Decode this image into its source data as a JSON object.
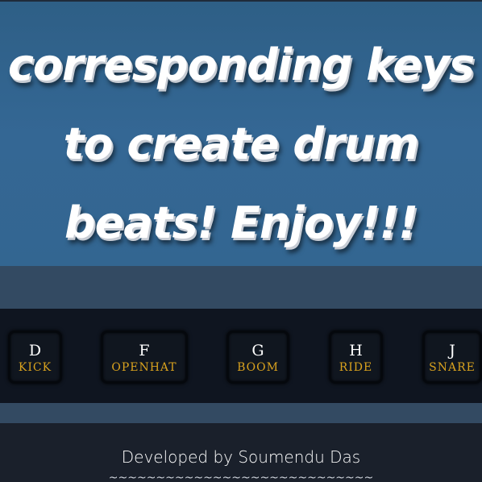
{
  "hero": {
    "line1": "corresponding keys",
    "line2": "to create drum",
    "line3": "beats! Enjoy!!!"
  },
  "keys": [
    {
      "letter": "D",
      "sound": "KICK"
    },
    {
      "letter": "F",
      "sound": "OPENHAT"
    },
    {
      "letter": "G",
      "sound": "BOOM"
    },
    {
      "letter": "H",
      "sound": "RIDE"
    },
    {
      "letter": "J",
      "sound": "SNARE"
    }
  ],
  "footer": {
    "credit": "Developed by Soumendu Das",
    "divider": "~~~~~~~~~~~~~~~~~~~~~~~~~~~~"
  },
  "colors": {
    "hero_bg": "#346794",
    "key_label": "#d9a21e",
    "strip_bg": "#0f1520",
    "band_bg": "#334a62"
  }
}
